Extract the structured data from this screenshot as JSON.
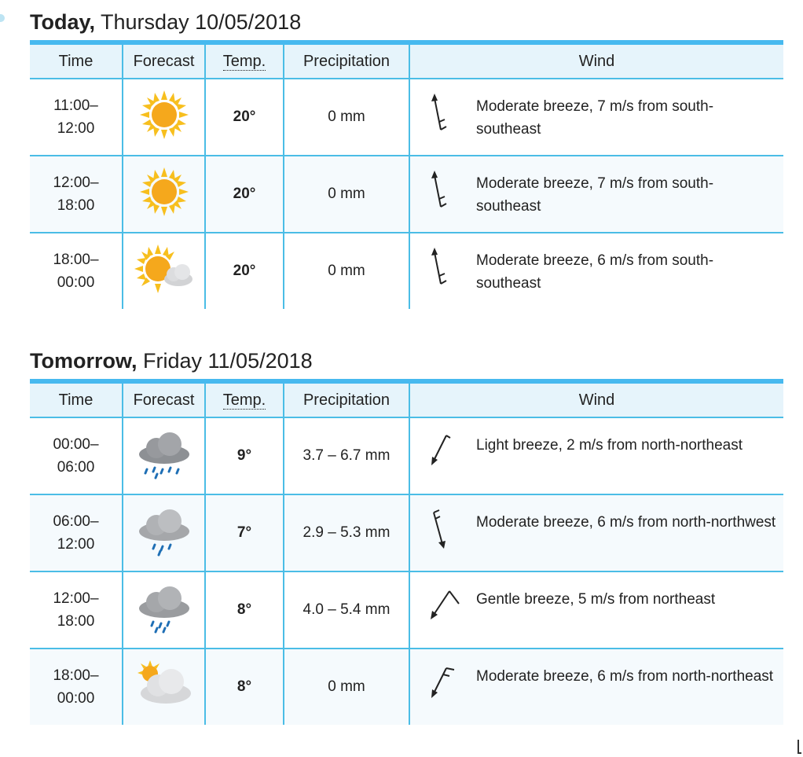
{
  "headers": {
    "time": "Time",
    "forecast": "Forecast",
    "temp": "Temp.",
    "precipitation": "Precipitation",
    "wind": "Wind"
  },
  "days": [
    {
      "label": "Today,",
      "date": "Thursday 10/05/2018",
      "rows": [
        {
          "time_start": "11:00–",
          "time_end": "12:00",
          "icon": "sun-icon",
          "temp": "20°",
          "precip": "0 mm",
          "wind": "Moderate breeze, 7 m/s from south-southeast"
        },
        {
          "time_start": "12:00–",
          "time_end": "18:00",
          "icon": "sun-icon",
          "temp": "20°",
          "precip": "0 mm",
          "wind": "Moderate breeze, 7 m/s from south-southeast"
        },
        {
          "time_start": "18:00–",
          "time_end": "00:00",
          "icon": "partly-cloudy-icon",
          "temp": "20°",
          "precip": "0 mm",
          "wind": "Moderate breeze, 6 m/s from south-southeast"
        }
      ]
    },
    {
      "label": "Tomorrow,",
      "date": "Friday 11/05/2018",
      "rows": [
        {
          "time_start": "00:00–",
          "time_end": "06:00",
          "icon": "heavy-rain-icon",
          "temp": "9°",
          "precip": "3.7 – 6.7 mm",
          "wind": "Light breeze, 2 m/s from north-northeast"
        },
        {
          "time_start": "06:00–",
          "time_end": "12:00",
          "icon": "light-rain-icon",
          "temp": "7°",
          "precip": "2.9 – 5.3 mm",
          "wind": "Moderate breeze, 6 m/s from north-northwest"
        },
        {
          "time_start": "12:00–",
          "time_end": "18:00",
          "icon": "rain-icon",
          "temp": "8°",
          "precip": "4.0 – 5.4 mm",
          "wind": "Gentle breeze, 5 m/s from northeast"
        },
        {
          "time_start": "18:00–",
          "time_end": "00:00",
          "icon": "cloudy-sun-icon",
          "temp": "8°",
          "precip": "0 mm",
          "wind": "Moderate breeze, 6 m/s from north-northeast"
        }
      ]
    }
  ]
}
